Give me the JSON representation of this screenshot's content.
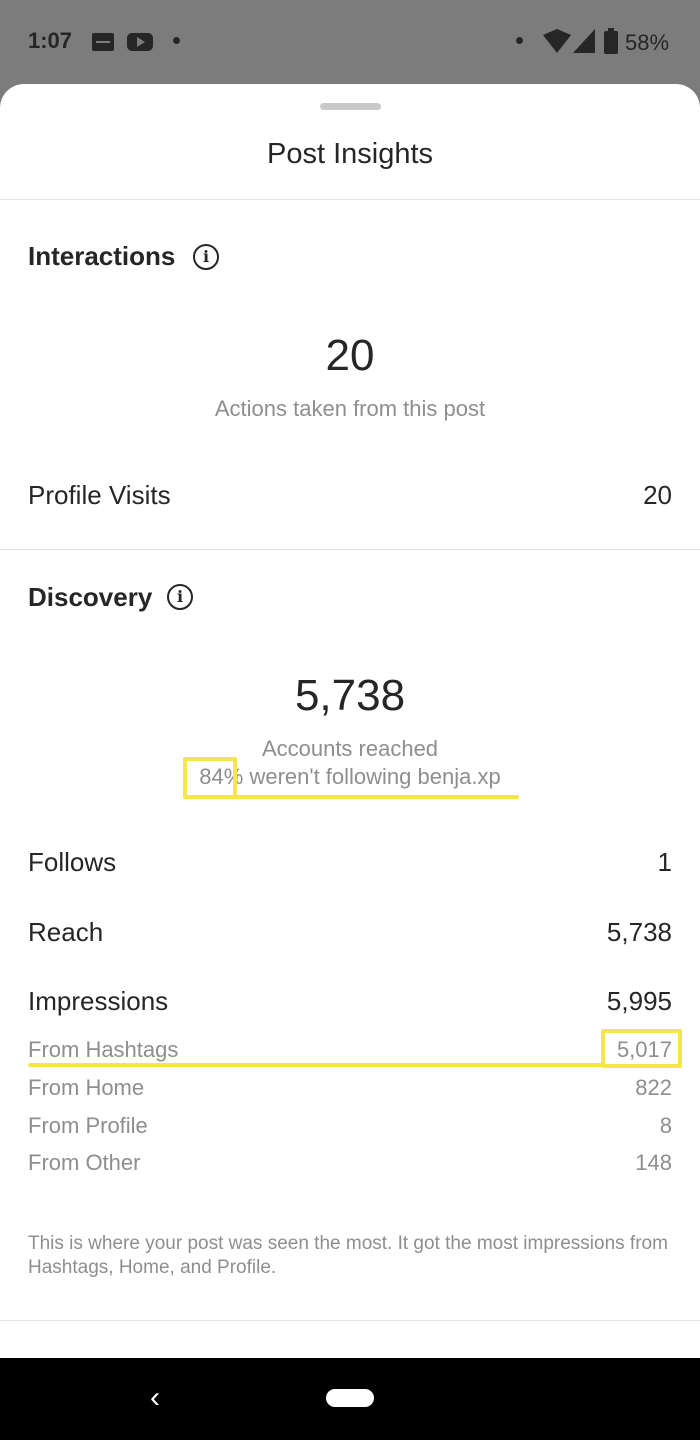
{
  "status_bar": {
    "time": "1:07",
    "battery": "58%",
    "icons": [
      "sonos-icon",
      "youtube-icon",
      "notification-dot-icon",
      "wifi-icon",
      "signal-icon",
      "battery-icon"
    ]
  },
  "sheet": {
    "title": "Post Insights"
  },
  "interactions": {
    "heading": "Interactions",
    "total": "20",
    "total_caption": "Actions taken from this post",
    "rows": [
      {
        "label": "Profile Visits",
        "value": "20"
      }
    ]
  },
  "discovery": {
    "heading": "Discovery",
    "total": "5,738",
    "total_caption": "Accounts reached",
    "follow_percent": "84%",
    "follow_caption": "weren't following benja.xp",
    "rows": [
      {
        "label": "Follows",
        "value": "1"
      },
      {
        "label": "Reach",
        "value": "5,738"
      },
      {
        "label": "Impressions",
        "value": "5,995"
      }
    ],
    "impression_sources": [
      {
        "label": "From Hashtags",
        "value": "5,017"
      },
      {
        "label": "From Home",
        "value": "822"
      },
      {
        "label": "From Profile",
        "value": "8"
      },
      {
        "label": "From Other",
        "value": "148"
      }
    ],
    "note": "This is where your post was seen the most. It got the most impressions from Hashtags, Home, and Profile."
  },
  "colors": {
    "highlight": "#f5e74a",
    "text_primary": "#262626",
    "text_secondary": "#8e8e8e"
  }
}
